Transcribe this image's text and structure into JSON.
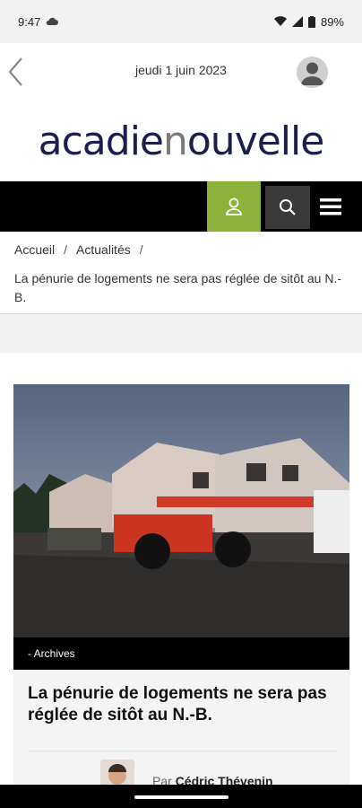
{
  "status": {
    "time": "9:47",
    "battery": "89%"
  },
  "header": {
    "date": "jeudi 1 juin 2023",
    "logo_part1": "acadie",
    "logo_part2": "n",
    "logo_part3": "ouvelle"
  },
  "breadcrumb": {
    "home": "Accueil",
    "separator": "/",
    "section": "Actualités",
    "current": "La pénurie de logements ne sera pas réglée de sitôt au N.-B."
  },
  "article": {
    "caption": "- Archives",
    "headline": "La pénurie de logements ne sera pas réglée de sitôt au N.-B.",
    "byline_prefix": "Par",
    "author": "Cédric Thévenin"
  },
  "colors": {
    "accent_green": "#8bb33b",
    "logo_navy": "#1a1f4f"
  },
  "icons": [
    "cloud-icon",
    "wifi-icon",
    "signal-icon",
    "battery-icon",
    "back-chevron-icon",
    "user-avatar-icon",
    "user-icon",
    "search-icon",
    "menu-icon"
  ]
}
